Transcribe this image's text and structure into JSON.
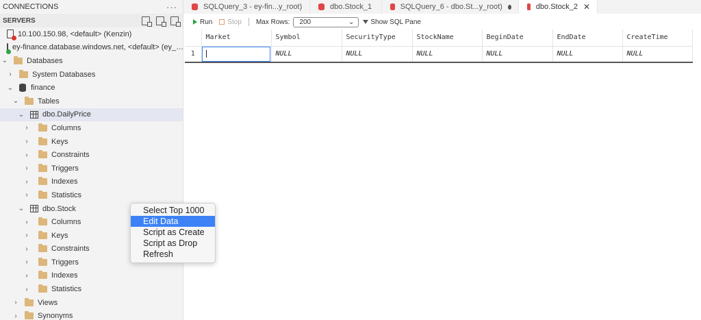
{
  "connections": {
    "title": "CONNECTIONS",
    "more": "···"
  },
  "servers": {
    "title": "SERVERS",
    "items": [
      {
        "label": "10.100.150.98, <default> (Kenzin)",
        "status": "red"
      },
      {
        "label": "ey-finance.database.windows.net, <default> (ey_…",
        "status": "green"
      }
    ]
  },
  "tree": {
    "databases": "Databases",
    "system_databases": "System Databases",
    "finance": "finance",
    "tables": "Tables",
    "daily_price": "dbo.DailyPrice",
    "dp_columns": "Columns",
    "dp_keys": "Keys",
    "dp_constraints": "Constraints",
    "dp_triggers": "Triggers",
    "dp_indexes": "Indexes",
    "dp_statistics": "Statistics",
    "stock": "dbo.Stock",
    "st_columns": "Columns",
    "st_keys": "Keys",
    "st_constraints": "Constraints",
    "st_triggers": "Triggers",
    "st_indexes": "Indexes",
    "st_statistics": "Statistics",
    "views": "Views",
    "synonyms": "Synonyms"
  },
  "context_menu": {
    "items": [
      "Select Top 1000",
      "Edit Data",
      "Script as Create",
      "Script as Drop",
      "Refresh"
    ],
    "active": "Edit Data"
  },
  "tabs": [
    {
      "label": "SQLQuery_3 - ey-fin...y_root)"
    },
    {
      "label": "dbo.Stock_1"
    },
    {
      "label": "SQLQuery_6 - dbo.St...y_root)"
    },
    {
      "label": "dbo.Stock_2"
    }
  ],
  "toolbar": {
    "run": "Run",
    "stop": "Stop",
    "max_rows_label": "Max Rows:",
    "max_rows_value": "200",
    "show_sql": "Show SQL Pane"
  },
  "grid": {
    "columns": [
      "Market",
      "Symbol",
      "SecurityType",
      "StockName",
      "BeginDate",
      "EndDate",
      "CreateTime"
    ],
    "rows": [
      {
        "num": "1",
        "cells": [
          "",
          "NULL",
          "NULL",
          "NULL",
          "NULL",
          "NULL",
          "NULL"
        ]
      }
    ]
  },
  "colors": {
    "accent": "#3c82f6",
    "folder": "#dcb67a",
    "error": "#d9342b",
    "ok": "#2ba640"
  }
}
